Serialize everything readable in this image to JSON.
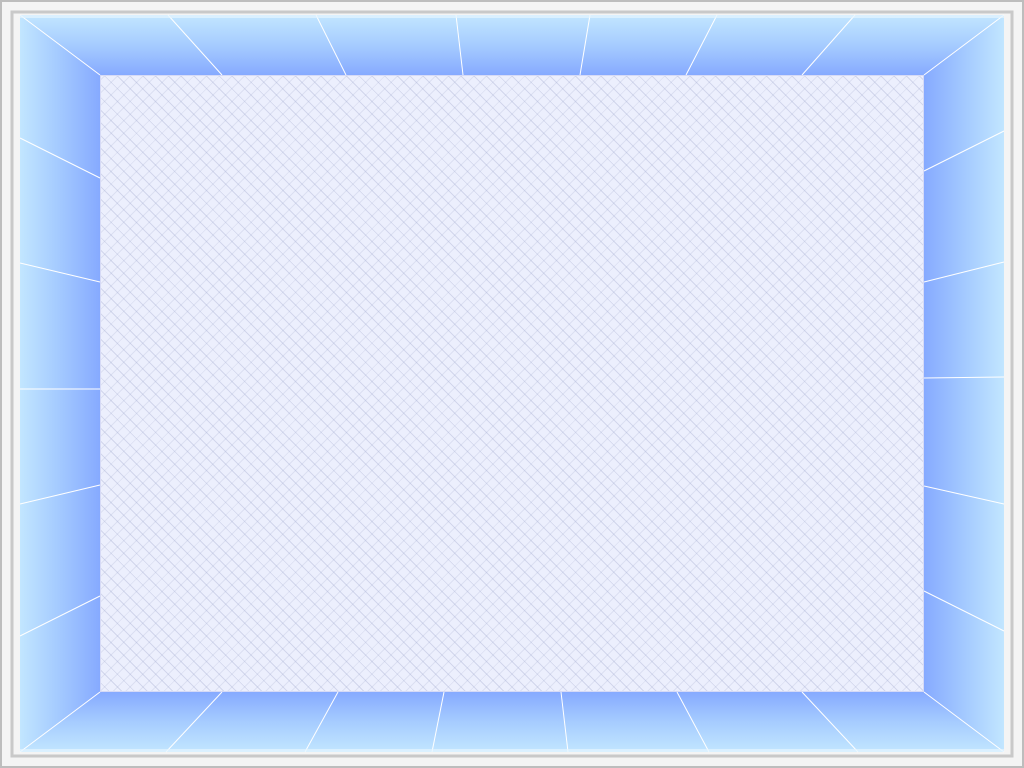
{
  "colors": {
    "outer_border": "#b8b8b8",
    "outer_gap": "#f4f4f4",
    "frame_light": "#bfe4ff",
    "frame_mid": "#a6ccff",
    "frame_deep": "#88acff",
    "frame_lines": "#ffffff",
    "panel_fill": "#eceffd",
    "panel_pattern": "#a0a8cd"
  },
  "panel": {
    "text": ""
  }
}
